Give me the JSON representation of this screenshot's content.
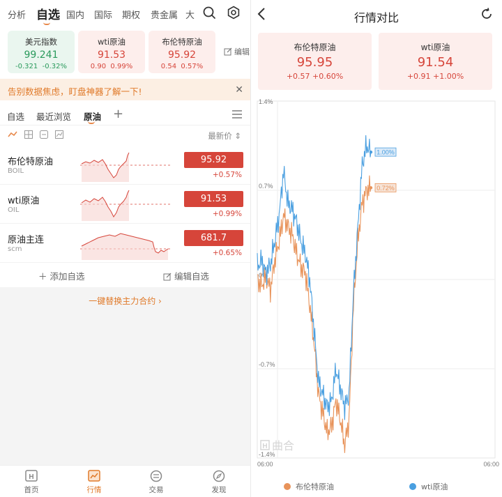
{
  "left": {
    "top_tabs": [
      "分析",
      "自选",
      "国内",
      "国际",
      "期权",
      "贵金属",
      "大"
    ],
    "active_tab": "自选",
    "cards": [
      {
        "name": "美元指数",
        "price": "99.241",
        "change": "-0.321",
        "pct": "-0.32%",
        "trend": "down"
      },
      {
        "name": "wti原油",
        "price": "91.53",
        "change": "0.90",
        "pct": "0.99%",
        "trend": "up"
      },
      {
        "name": "布伦特原油",
        "price": "95.92",
        "change": "0.54",
        "pct": "0.57%",
        "trend": "up"
      }
    ],
    "edit_label": "编辑",
    "banner_text": "告别数据焦虑，盯盘神器了解一下!",
    "sub_tabs": [
      "自选",
      "最近浏览",
      "原油"
    ],
    "active_sub_tab": "原油",
    "sort_label": "最新价",
    "rows": [
      {
        "name": "布伦特原油",
        "code": "BOIL",
        "price": "95.92",
        "pct": "+0.57%"
      },
      {
        "name": "wti原油",
        "code": "OIL",
        "price": "91.53",
        "pct": "+0.99%"
      },
      {
        "name": "原油主连",
        "code": "scm",
        "price": "681.7",
        "pct": "+0.65%"
      }
    ],
    "add_label": "添加自选",
    "edit_watch_label": "编辑自选",
    "replace_link": "一键替换主力合约 ›",
    "bottom_nav": [
      "首页",
      "行情",
      "交易",
      "发现"
    ],
    "active_nav": "行情"
  },
  "right": {
    "title": "行情对比",
    "cards": [
      {
        "name": "布伦特原油",
        "price": "95.95",
        "change": "+0.57 +0.60%"
      },
      {
        "name": "wti原油",
        "price": "91.54",
        "change": "+0.91 +1.00%"
      }
    ],
    "watermark": "曲合",
    "watermark_mark": "H"
  },
  "colors": {
    "accent": "#e07a2a",
    "up": "#d6453a",
    "down": "#2a9a5c",
    "brent_line": "#e8935a",
    "wti_line": "#4a9fe0"
  },
  "chart_data": {
    "type": "line",
    "x": [
      "06:00",
      "06:00"
    ],
    "ylim": [
      -1.4,
      1.4
    ],
    "y_ticks": [
      "1.4%",
      "0.7%",
      "0%",
      "-0.7%",
      "-1.4%"
    ],
    "x_ticks": [
      "06:00",
      "06:00"
    ],
    "series": [
      {
        "name": "布伦特原油",
        "last_label": "0.72%",
        "values": [
          0.0,
          -0.05,
          0.02,
          -0.08,
          0.15,
          0.3,
          0.5,
          0.42,
          0.35,
          0.2,
          0.1,
          0.05,
          -0.2,
          -0.5,
          -0.9,
          -1.05,
          -1.2,
          -1.15,
          -0.95,
          -1.1,
          -1.3,
          -1.1,
          -0.2,
          0.3,
          0.6,
          0.7,
          0.72
        ]
      },
      {
        "name": "wti原油",
        "last_label": "1.00%",
        "values": [
          0.1,
          0.15,
          0.05,
          0.12,
          0.3,
          0.5,
          0.85,
          0.6,
          0.55,
          0.45,
          0.3,
          0.2,
          0.0,
          -0.4,
          -0.8,
          -0.9,
          -1.0,
          -0.95,
          -0.7,
          -0.85,
          -1.0,
          -0.9,
          -0.1,
          0.4,
          0.9,
          1.05,
          1.0
        ]
      }
    ],
    "grid": true,
    "legend": "bottom"
  }
}
